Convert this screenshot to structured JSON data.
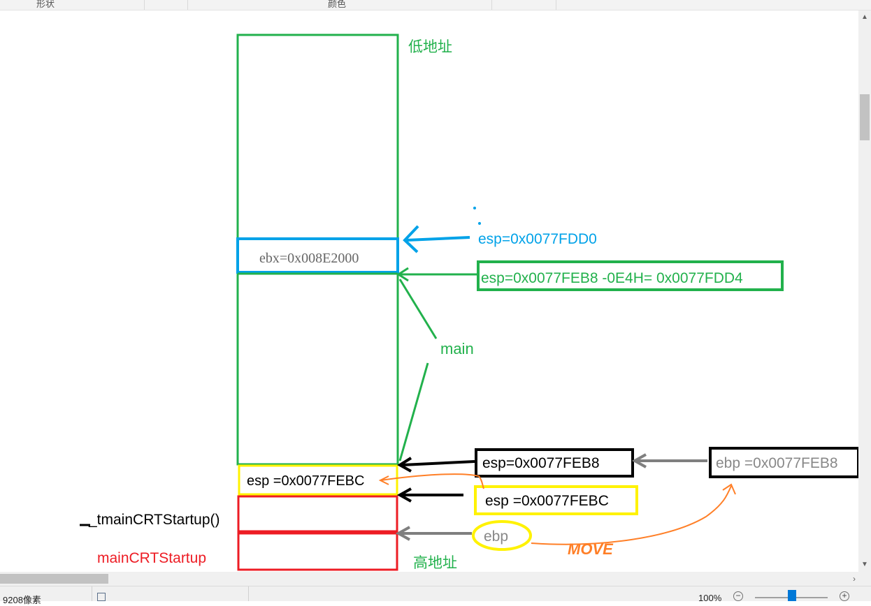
{
  "ribbon": {
    "shapes_label": "形状",
    "colors_label": "颜色"
  },
  "diagram": {
    "low_address": "低地址",
    "high_address": "高地址",
    "main": "main",
    "ebx_cell": "ebx=0x008E2000",
    "esp_fdd0": "esp=0x0077FDD0",
    "esp_calc": "esp=0x0077FEB8 -0E4H= 0x0077FDD4",
    "esp_feb8": "esp=0x0077FEB8",
    "esp_febc_cell": "esp =0x0077FEBC",
    "esp_febc_box": "esp  =0x0077FEBC",
    "ebp_feb8": "ebp =0x0077FEB8",
    "ebp": "ebp",
    "tmain_label": "_tmainCRTStartup()",
    "main_crt_label": "mainCRTStartup",
    "move_annotation": "MOVE"
  },
  "colors": {
    "green": "#22b14c",
    "blue": "#00a2e8",
    "red": "#ed1c24",
    "yellow": "#fff200",
    "orange": "#ff7f27",
    "gray": "#7f7f7f",
    "black": "#000000"
  },
  "status": {
    "image_size": "9208像素",
    "zoom": "100%"
  }
}
